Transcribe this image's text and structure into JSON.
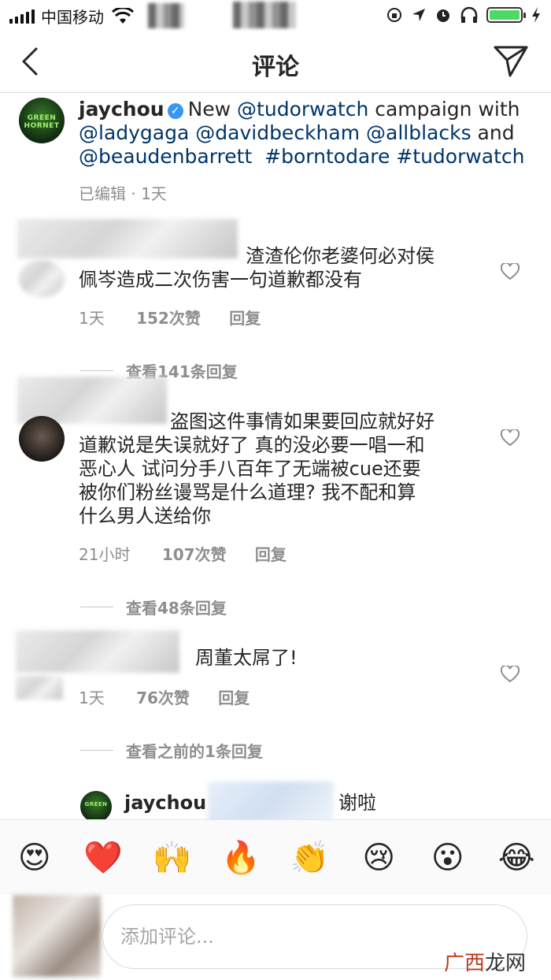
{
  "status_bar": {
    "carrier": "中国移动"
  },
  "nav": {
    "title": "评论"
  },
  "post": {
    "username": "jaychou",
    "text_parts": [
      "New ",
      "@tudorwatch",
      " campaign with ",
      "@ladygaga",
      " ",
      "@davidbeckham",
      " ",
      "@allblacks",
      " and ",
      "@beaudenbarrett",
      "  ",
      "#borntodare",
      " ",
      "#tudorwatch"
    ],
    "edited": "已编辑",
    "time": "1天"
  },
  "comments": [
    {
      "line1": "渣渣伦你老婆何必对侯",
      "line2": "佩岑造成二次伤害一句道歉都没有",
      "time": "1天",
      "likes": "152次赞",
      "reply": "回复",
      "view_replies": "查看141条回复"
    },
    {
      "line1": "盗图这件事情如果要回应就好好",
      "line2": "道歉说是失误就好了 真的没必要一唱一和",
      "line3": "恶心人 试问分手八百年了无端被cue还要",
      "line4": "被你们粉丝谩骂是什么道理? 我不配和算",
      "line5": "什么男人送给你",
      "time": "21小时",
      "likes": "107次赞",
      "reply": "回复",
      "view_replies": "查看48条回复"
    },
    {
      "line1": "周董太屌了!",
      "time": "1天",
      "likes": "76次赞",
      "reply": "回复",
      "view_replies": "查看之前的1条回复"
    }
  ],
  "nested_reply": {
    "username": "jaychou",
    "text": "谢啦"
  },
  "emojis": [
    "😍",
    "❤️",
    "🙌",
    "🔥",
    "👏",
    "😢",
    "😮",
    "😂"
  ],
  "comment_input": {
    "placeholder": "添加评论..."
  },
  "watermark": {
    "a": "广西",
    "b": "龙网"
  },
  "colors": {
    "link": "#003569",
    "meta": "#8e8e8e",
    "verified": "#3897f0",
    "battery": "#4cd964"
  }
}
